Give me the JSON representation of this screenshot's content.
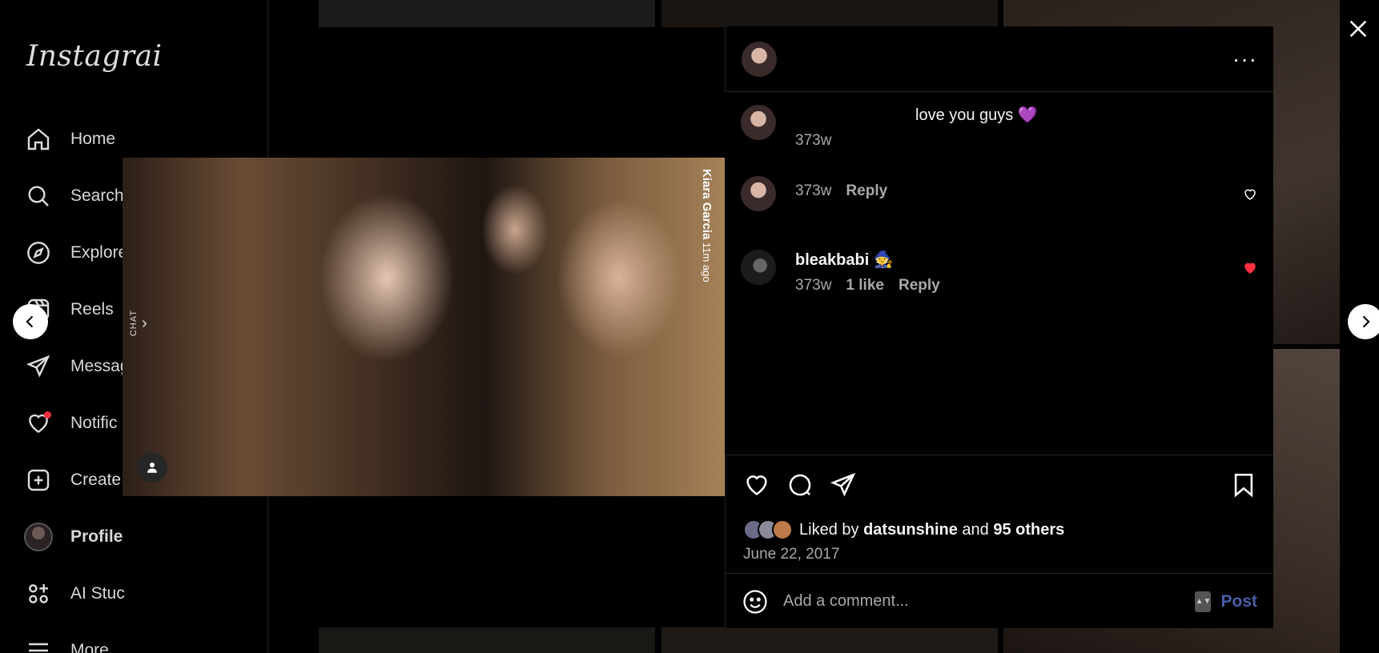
{
  "sidebar": {
    "logo": "Instagrai",
    "items": [
      {
        "label": "Home",
        "icon": "home-icon"
      },
      {
        "label": "Search",
        "icon": "search-icon"
      },
      {
        "label": "Explore",
        "icon": "compass-icon"
      },
      {
        "label": "Reels",
        "icon": "reels-icon"
      },
      {
        "label": "Messag",
        "icon": "send-icon"
      },
      {
        "label": "Notific",
        "icon": "heart-icon"
      },
      {
        "label": "Create",
        "icon": "plus-square-icon"
      },
      {
        "label": "Profile",
        "icon": "avatar"
      },
      {
        "label": "AI Stuc",
        "icon": "ai-studio-icon"
      },
      {
        "label": "More",
        "icon": "menu-icon"
      }
    ]
  },
  "photo": {
    "side_name": "Kiara Garcia",
    "side_time": "11m ago",
    "chat_label": "CHAT"
  },
  "post": {
    "header_user": "",
    "comments": [
      {
        "user": "",
        "text": "love you guys 💜",
        "time": "373w",
        "reply": "",
        "likes": ""
      },
      {
        "user": "",
        "text": "",
        "time": "373w",
        "reply": "Reply",
        "likes": ""
      },
      {
        "user": "bleakbabi",
        "text": "🧙",
        "time": "373w",
        "reply": "Reply",
        "likes": "1 like"
      }
    ],
    "liked_by_prefix": "Liked by",
    "liked_by_user": "datsunshine",
    "liked_by_and": "and",
    "liked_by_others": "95 others",
    "date": "June 22, 2017",
    "comment_placeholder": "Add a comment...",
    "post_label": "Post"
  },
  "colors": {
    "background": "#000000",
    "liked_heart": "#ff3040",
    "post_button": "#4a5fa8",
    "notification_dot": "#ff3040"
  }
}
